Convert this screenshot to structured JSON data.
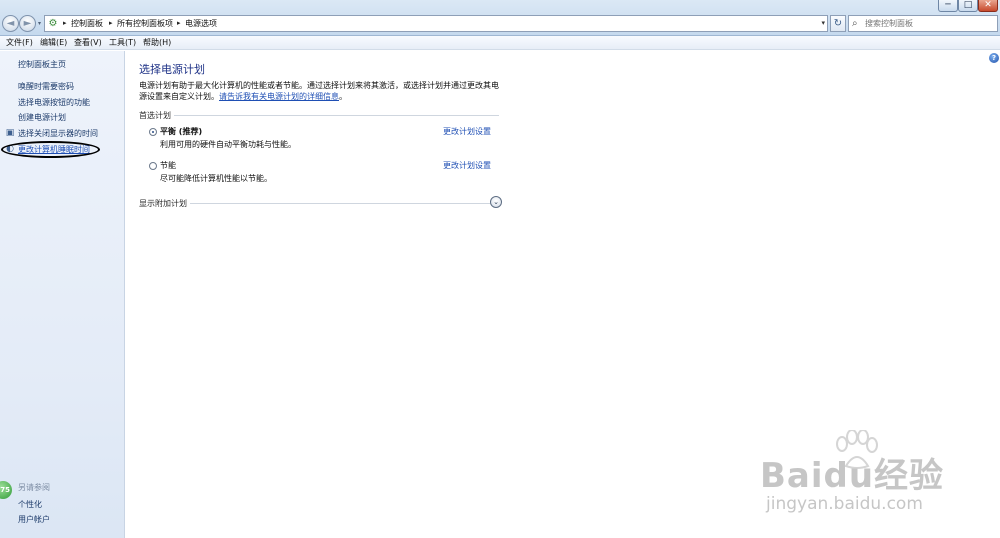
{
  "window": {
    "minimize": "─",
    "maximize": "□",
    "close": "✕"
  },
  "nav": {
    "back_symbol": "◄",
    "forward_symbol": "►"
  },
  "address": {
    "breadcrumbs": [
      "控制面板",
      "所有控制面板项",
      "电源选项"
    ],
    "separator": "▸",
    "dropdown": "▾"
  },
  "refresh_symbol": "↻",
  "search": {
    "placeholder": "搜索控制面板"
  },
  "menubar": {
    "items": [
      "文件(F)",
      "编辑(E)",
      "查看(V)",
      "工具(T)",
      "帮助(H)"
    ]
  },
  "sidebar": {
    "home": "控制面板主页",
    "links": [
      "唤醒时需要密码",
      "选择电源按钮的功能",
      "创建电源计划",
      "选择关闭显示器的时间",
      "更改计算机睡眠时间"
    ],
    "see_also_title": "另请参阅",
    "see_also_links": [
      "个性化",
      "用户帐户"
    ],
    "badge_value": "75"
  },
  "main": {
    "title": "选择电源计划",
    "description": "电源计划有助于最大化计算机的性能或者节能。通过选择计划来将其激活，或选择计划并通过更改其电源设置来自定义计划。",
    "description_link": "请告诉我有关电源计划的详细信息",
    "description_end": "。",
    "preferred_label": "首选计划",
    "plans": [
      {
        "name": "平衡 (推荐)",
        "description": "利用可用的硬件自动平衡功耗与性能。",
        "link": "更改计划设置",
        "selected": true
      },
      {
        "name": "节能",
        "description": "尽可能降低计算机性能以节能。",
        "link": "更改计划设置",
        "selected": false
      }
    ],
    "extra_plans_label": "显示附加计划",
    "expand_symbol": "⌄"
  },
  "help_symbol": "?",
  "watermark": {
    "brand": "Baidu经验",
    "url": "jingyan.baidu.com"
  }
}
